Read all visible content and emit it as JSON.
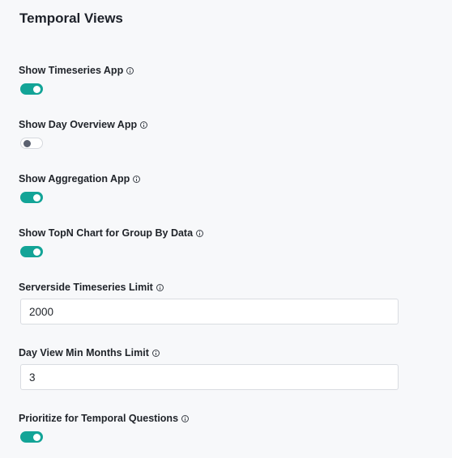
{
  "section": {
    "title": "Temporal Views"
  },
  "settings": [
    {
      "label": "Show Timeseries App",
      "type": "toggle",
      "enabled": true
    },
    {
      "label": "Show Day Overview App",
      "type": "toggle",
      "enabled": false
    },
    {
      "label": "Show Aggregation App",
      "type": "toggle",
      "enabled": true
    },
    {
      "label": "Show TopN Chart for Group By Data",
      "type": "toggle",
      "enabled": true
    },
    {
      "label": "Serverside Timeseries Limit",
      "type": "number",
      "value": "2000"
    },
    {
      "label": "Day View Min Months Limit",
      "type": "number",
      "value": "3"
    },
    {
      "label": "Prioritize for Temporal Questions",
      "type": "toggle",
      "enabled": true
    }
  ],
  "colors": {
    "toggle_on": "#13a497",
    "toggle_off_knob": "#5b6170",
    "background": "#f7f8fa"
  },
  "icons": {
    "info": "info-circle-icon"
  }
}
